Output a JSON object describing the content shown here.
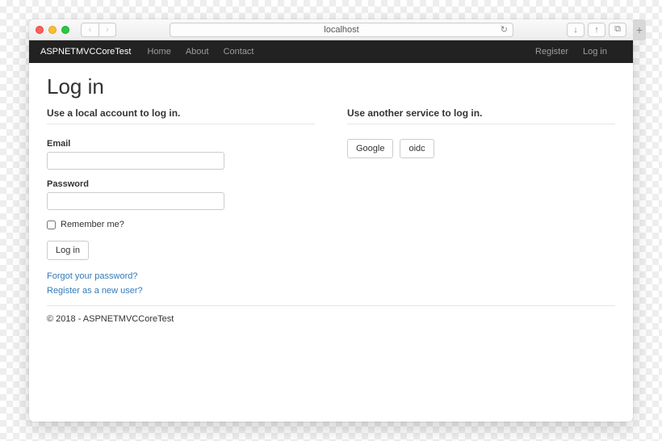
{
  "browser": {
    "url": "localhost"
  },
  "navbar": {
    "brand": "ASPNETMVCCoreTest",
    "links": [
      "Home",
      "About",
      "Contact"
    ],
    "right": [
      "Register",
      "Log in"
    ]
  },
  "page": {
    "title": "Log in",
    "local": {
      "heading": "Use a local account to log in.",
      "email_label": "Email",
      "password_label": "Password",
      "remember_label": "Remember me?",
      "submit_label": "Log in",
      "forgot_link": "Forgot your password?",
      "register_link": "Register as a new user?"
    },
    "external": {
      "heading": "Use another service to log in.",
      "providers": [
        "Google",
        "oidc"
      ]
    }
  },
  "footer": "© 2018 - ASPNETMVCCoreTest"
}
